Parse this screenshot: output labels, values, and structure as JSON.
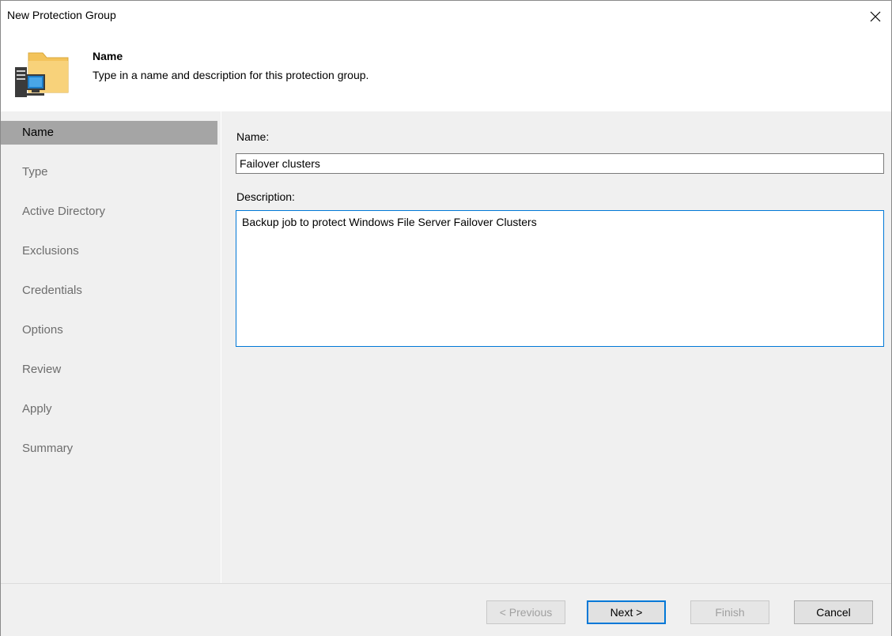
{
  "window": {
    "title": "New Protection Group"
  },
  "header": {
    "title": "Name",
    "description": "Type in a name and description for this protection group.",
    "icon": "folder-server-icon"
  },
  "steps": [
    "Name",
    "Type",
    "Active Directory",
    "Exclusions",
    "Credentials",
    "Options",
    "Review",
    "Apply",
    "Summary"
  ],
  "active_step": "Name",
  "form": {
    "name_label": "Name:",
    "name_value": "Failover clusters",
    "description_label": "Description:",
    "description_value": "Backup job to protect Windows File Server Failover Clusters"
  },
  "buttons": {
    "previous": "< Previous",
    "next": "Next >",
    "finish": "Finish",
    "cancel": "Cancel"
  },
  "colors": {
    "accent": "#0078d7",
    "active_step_bg": "#a5a5a5",
    "panel_bg": "#f0f0f0"
  }
}
